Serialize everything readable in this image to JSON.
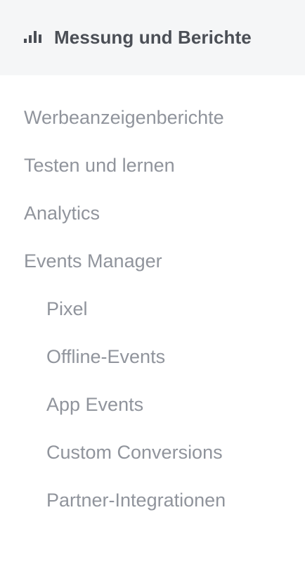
{
  "header": {
    "icon": "bar-chart-icon",
    "title": "Messung und Berichte"
  },
  "nav": {
    "items": [
      {
        "label": "Werbeanzeigenberichte",
        "level": 0
      },
      {
        "label": "Testen und lernen",
        "level": 0
      },
      {
        "label": "Analytics",
        "level": 0
      },
      {
        "label": "Events Manager",
        "level": 0
      },
      {
        "label": "Pixel",
        "level": 1
      },
      {
        "label": "Offline-Events",
        "level": 1
      },
      {
        "label": "App Events",
        "level": 1
      },
      {
        "label": "Custom Conversions",
        "level": 1
      },
      {
        "label": "Partner-Integrationen",
        "level": 1
      }
    ]
  },
  "colors": {
    "header_bg": "#f5f6f7",
    "header_text": "#4b4f56",
    "nav_text": "#90949c"
  }
}
